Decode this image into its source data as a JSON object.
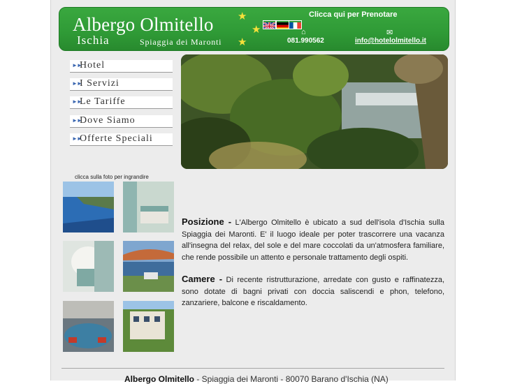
{
  "header": {
    "brand_main": "Albergo Olmitello",
    "brand_sub_a": "Ischia",
    "brand_sub_b": "Spiaggia dei Maronti",
    "booking_label": "Clicca qui per Prenotare",
    "phone": "081.990562",
    "email": "info@hotelolmitello.it",
    "flags": [
      "flag-uk-icon",
      "flag-de-icon",
      "flag-fr-icon"
    ],
    "accent_color": "#2f9a36",
    "star_color": "#f5e03a"
  },
  "menu": {
    "items": [
      {
        "label": "Hotel"
      },
      {
        "label": "I Servizi"
      },
      {
        "label": "Le Tariffe"
      },
      {
        "label": "Dove Siamo"
      },
      {
        "label": "Offerte Speciali"
      }
    ]
  },
  "gallery": {
    "caption": "clicca sulla foto per ingrandire"
  },
  "content": {
    "posizione_heading": "Posizione -",
    "posizione_text": "L'Albergo Olmitello è ubicato a sud dell'isola d'Ischia sulla Spiaggia dei Maronti. E' il luogo ideale per poter trascorrere una vacanza all'insegna del relax, del sole e del mare coccolati da un'atmosfera familiare, che rende possibile un attento e personale trattamento degli ospiti.",
    "camere_heading": "Camere -",
    "camere_text": "Di recente ristrutturazione, arredate con gusto e raffinatezza, sono dotate di bagni privati con doccia saliscendi e phon, telefono, zanzariere, balcone e riscaldamento."
  },
  "footer": {
    "name": "Albergo Olmitello",
    "address": " - Spiaggia dei Maronti - 80070 Barano d'Ischia (NA)"
  }
}
